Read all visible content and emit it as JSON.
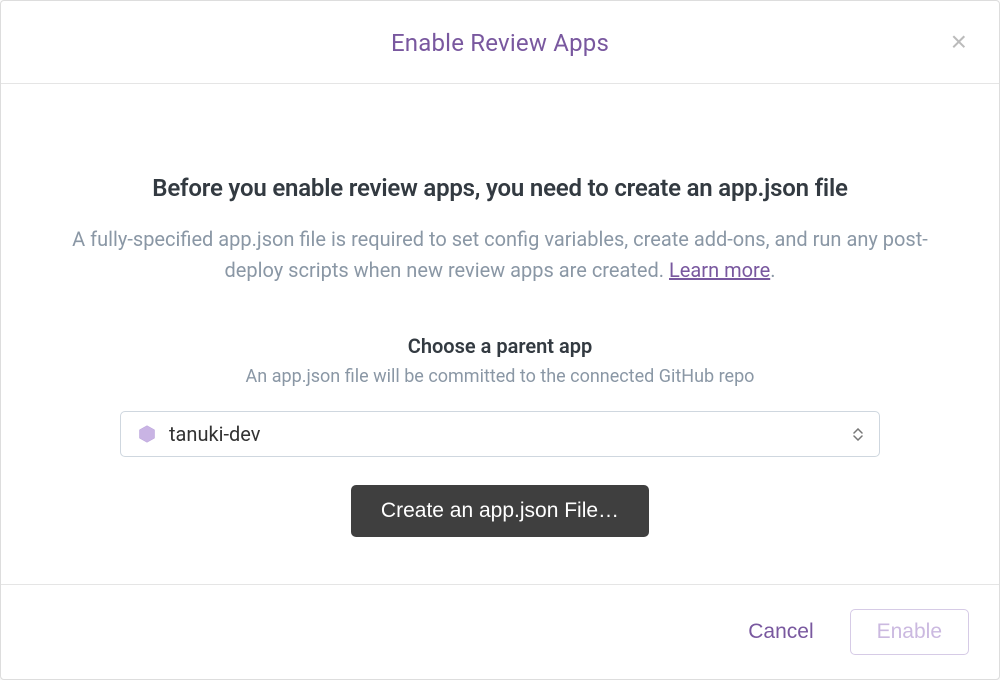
{
  "modal": {
    "title": "Enable Review Apps",
    "heading": "Before you enable review apps, you need to create an app.json file",
    "description_prefix": "A fully-specified app.json file is required to set config variables, create add-ons, and run any post-deploy scripts when new review apps are created. ",
    "learn_more": "Learn more",
    "description_suffix": ".",
    "parent_app": {
      "label": "Choose a parent app",
      "sublabel": "An app.json file will be committed to the connected GitHub repo",
      "selected": "tanuki-dev"
    },
    "create_button": "Create an app.json File…",
    "footer": {
      "cancel": "Cancel",
      "enable": "Enable"
    }
  }
}
